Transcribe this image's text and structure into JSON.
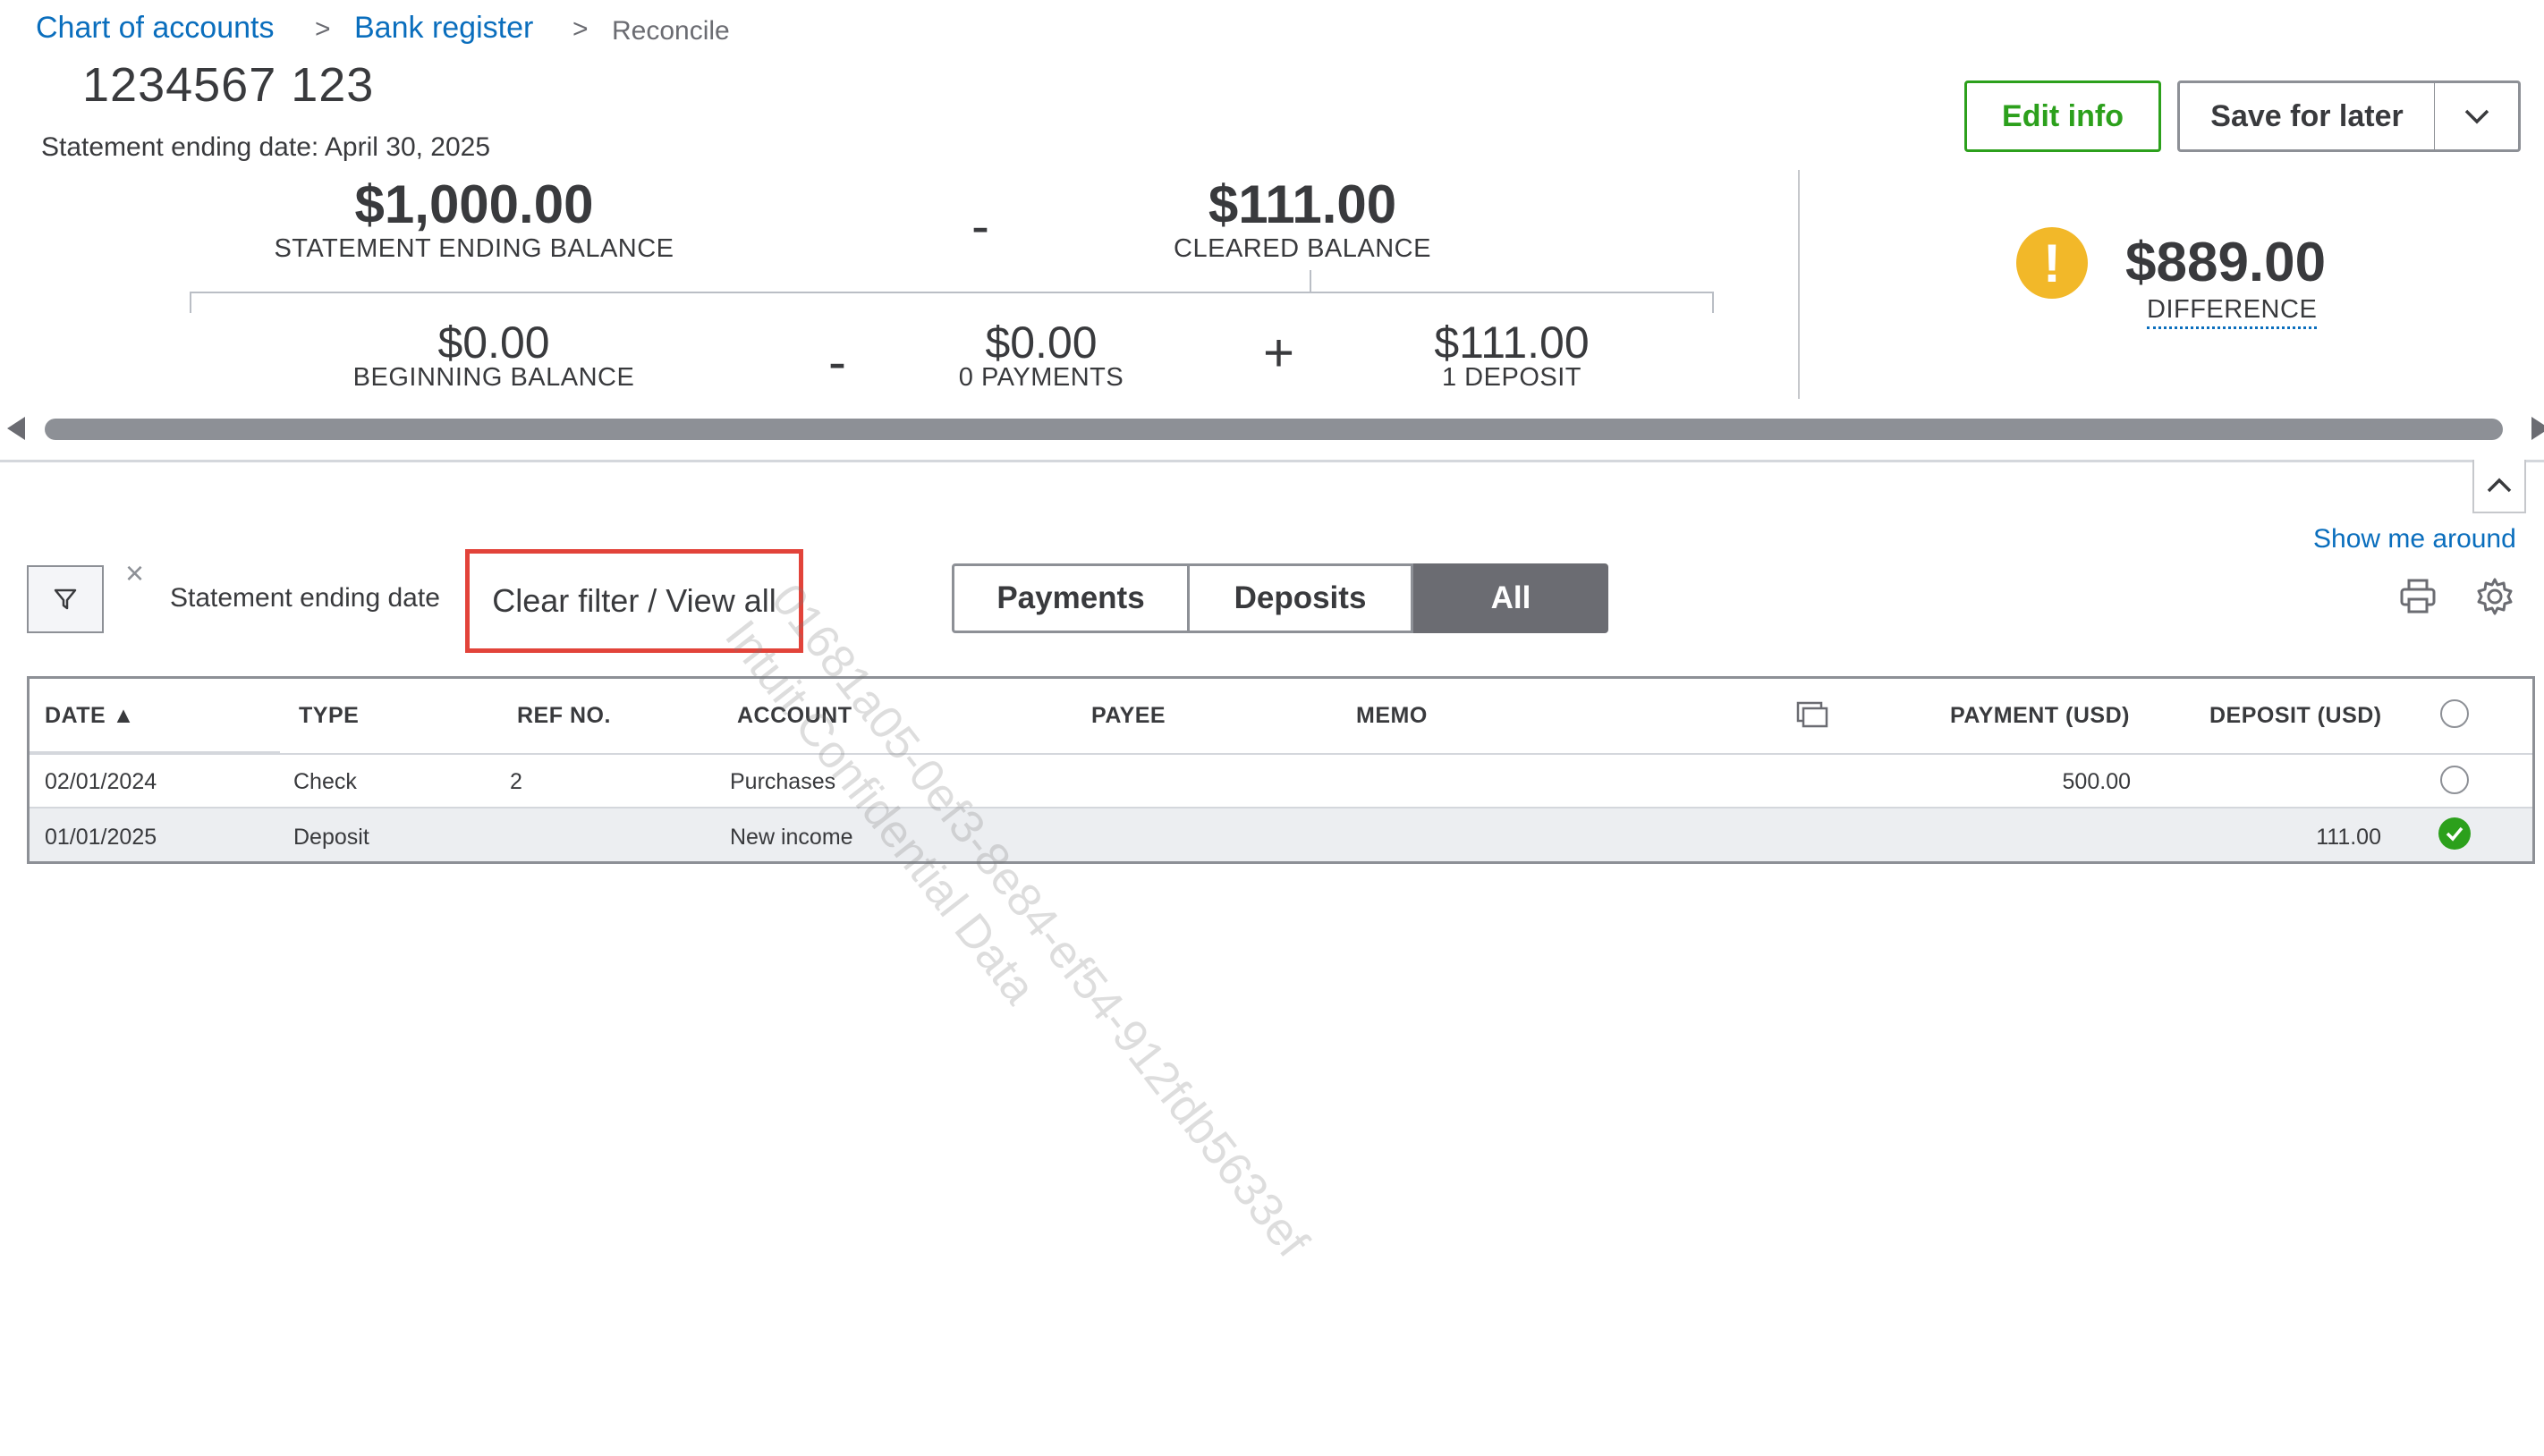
{
  "breadcrumb": {
    "items": [
      "Chart of accounts",
      "Bank register"
    ],
    "current": "Reconcile",
    "separator": ">"
  },
  "account": {
    "title": "1234567 123",
    "statement_date": "Statement ending date: April 30, 2025"
  },
  "actions": {
    "edit_info": "Edit info",
    "save_for_later": "Save for later"
  },
  "summary": {
    "statement_ending_balance": "$1,000.00",
    "statement_ending_balance_label": "STATEMENT ENDING BALANCE",
    "minus_1": "-",
    "cleared_balance": "$111.00",
    "cleared_balance_label": "CLEARED BALANCE",
    "beginning_balance": "$0.00",
    "beginning_balance_label": "BEGINNING BALANCE",
    "minus_2": "-",
    "payments": "$0.00",
    "payments_label": "0 PAYMENTS",
    "plus": "+",
    "deposits": "$111.00",
    "deposits_label": "1 DEPOSIT",
    "difference": "$889.00",
    "difference_label": "DIFFERENCE",
    "warning_glyph": "!"
  },
  "help": {
    "show_me_around": "Show me around"
  },
  "filter": {
    "close_glyph": "×",
    "label": "Statement ending date",
    "clear": "Clear filter / View all"
  },
  "segments": {
    "payments": "Payments",
    "deposits": "Deposits",
    "all": "All",
    "selected": "All"
  },
  "table": {
    "headers": {
      "date": "DATE ▲",
      "type": "TYPE",
      "ref": "REF NO.",
      "account": "ACCOUNT",
      "payee": "PAYEE",
      "memo": "MEMO",
      "payment": "PAYMENT (USD)",
      "deposit": "DEPOSIT (USD)"
    },
    "rows": [
      {
        "date": "02/01/2024",
        "type": "Check",
        "ref": "2",
        "account": "Purchases",
        "payee": "",
        "memo": "",
        "payment": "500.00",
        "deposit": "",
        "cleared": false
      },
      {
        "date": "01/01/2025",
        "type": "Deposit",
        "ref": "",
        "account": "New income",
        "payee": "",
        "memo": "",
        "payment": "",
        "deposit": "111.00",
        "cleared": true
      }
    ]
  },
  "watermark": {
    "line1": "01681a05-0ef3-8e84-ef54-912fdb5633ef",
    "line2": "Intuit Confidential Data"
  },
  "icons": {
    "filter": "filter-funnel-icon",
    "print": "print-icon",
    "settings": "gear-icon",
    "columns": "columns-icon",
    "collapse": "chevron-up-icon",
    "dropdown": "chevron-down-icon"
  },
  "colors": {
    "accent_green": "#2ca01c",
    "link_blue": "#0a6ebd",
    "warning": "#f2b829",
    "highlight_red": "#e2433a",
    "segment_selected": "#6b6c72"
  }
}
